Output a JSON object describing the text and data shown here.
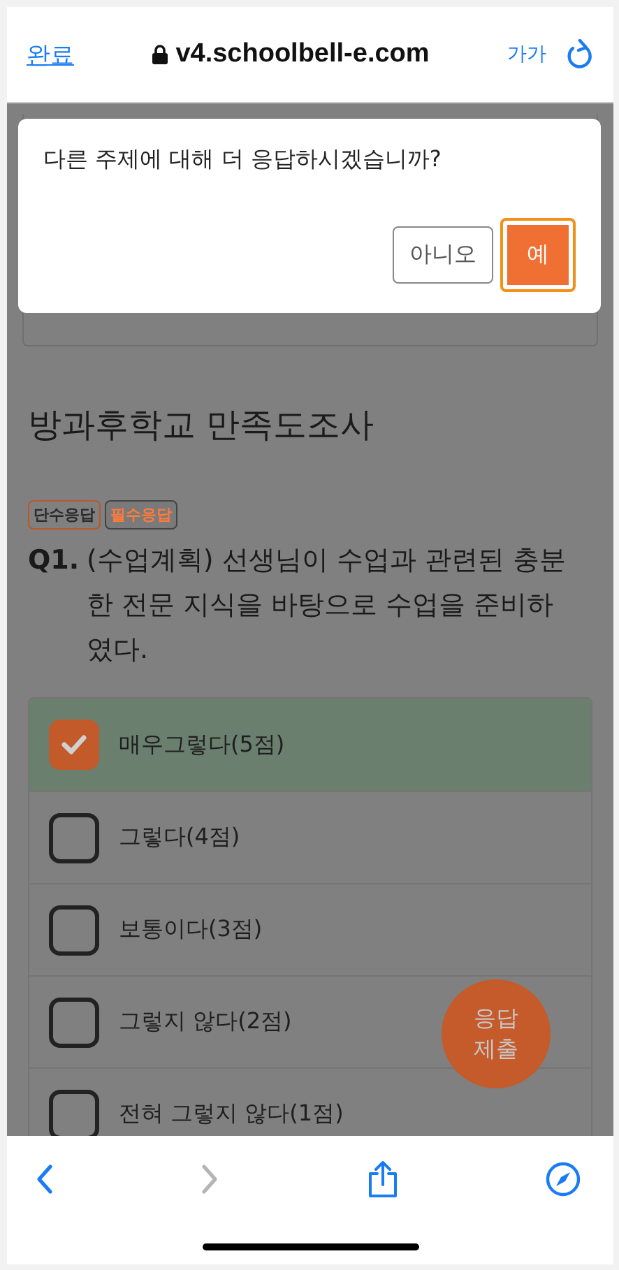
{
  "browser": {
    "done_label": "완료",
    "url": "v4.schoolbell-e.com",
    "text_size_label": "가가"
  },
  "dialog": {
    "message": "다른 주제에 대해 더 응답하시겠습니까?",
    "buttons": [
      {
        "label": "아니오",
        "kind": "secondary",
        "focused": false
      },
      {
        "label": "예",
        "kind": "primary",
        "focused": true
      }
    ]
  },
  "survey": {
    "title": "방과후학교 만족도조사",
    "tags": [
      {
        "label": "단수응답",
        "kind": "type"
      },
      {
        "label": "필수응답",
        "kind": "required"
      }
    ],
    "question": {
      "number": "Q1.",
      "text": "(수업계획) 선생님이 수업과 관련된 충분한 전문 지식을 바탕으로 수업을 준비하였다."
    },
    "options": [
      {
        "label": "매우그렇다(5점)",
        "checked": true
      },
      {
        "label": "그렇다(4점)",
        "checked": false
      },
      {
        "label": "보통이다(3점)",
        "checked": false
      },
      {
        "label": "그렇지 않다(2점)",
        "checked": false
      },
      {
        "label": "전혀 그렇지 않다(1점)",
        "checked": false
      }
    ],
    "submit_button": {
      "label": "응답 제출"
    }
  },
  "toolbar": [
    {
      "kind": "back",
      "disabled": false
    },
    {
      "kind": "forward",
      "disabled": true
    },
    {
      "kind": "share",
      "disabled": false
    },
    {
      "kind": "compass",
      "disabled": false
    }
  ]
}
